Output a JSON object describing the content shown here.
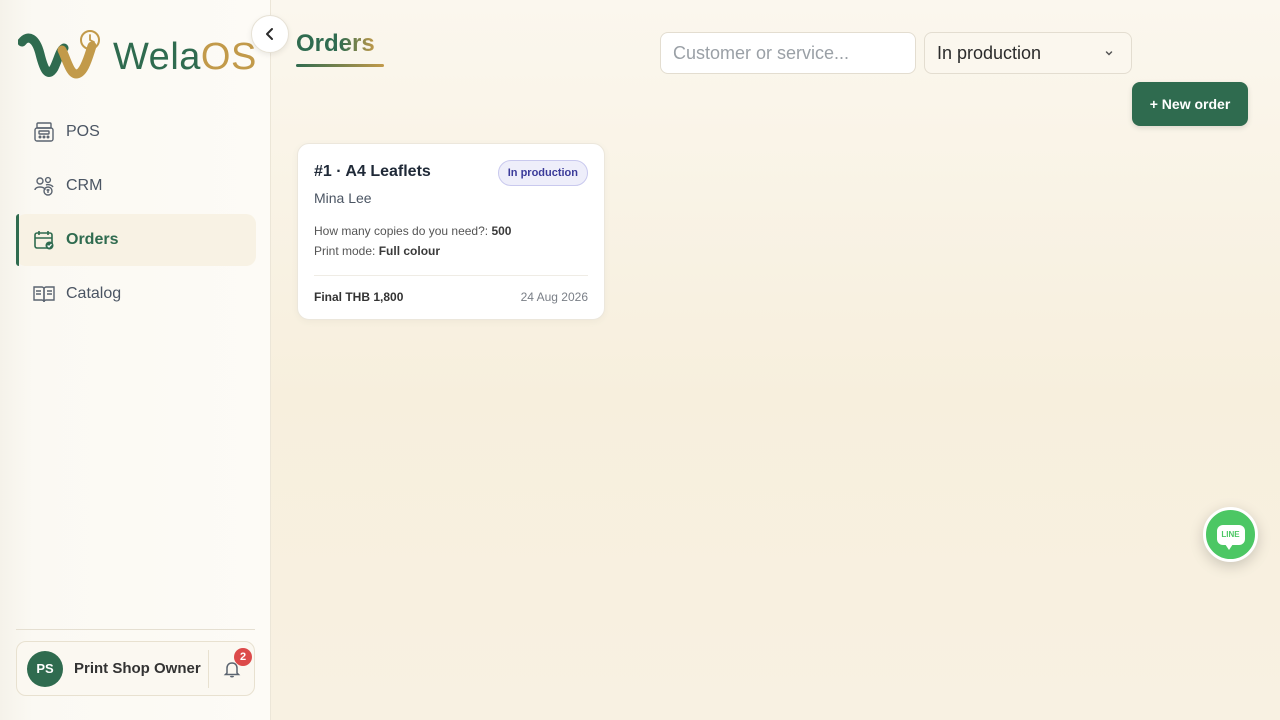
{
  "brand": {
    "name_part1": "Wela",
    "name_part2": "OS"
  },
  "sidebar": {
    "items": [
      {
        "label": "POS",
        "icon": "cash-register-icon",
        "active": false
      },
      {
        "label": "CRM",
        "icon": "customers-icon",
        "active": false
      },
      {
        "label": "Orders",
        "icon": "calendar-check-icon",
        "active": true
      },
      {
        "label": "Catalog",
        "icon": "catalog-book-icon",
        "active": false
      }
    ],
    "user": {
      "initials": "PS",
      "name": "Print Shop Owner",
      "notifications": "2"
    }
  },
  "header": {
    "title": "Orders",
    "search_placeholder": "Customer or service...",
    "status_filter": "In production",
    "new_order_label": "+ New order"
  },
  "orders": [
    {
      "title": "#1 · A4 Leaflets",
      "status": "In production",
      "customer": "Mina Lee",
      "fields": [
        {
          "label": "How many copies do you need?: ",
          "value": "500"
        },
        {
          "label": "Print mode: ",
          "value": "Full colour"
        }
      ],
      "total": "Final THB 1,800",
      "date": "24 Aug 2026"
    }
  ],
  "fab": {
    "label": "LINE"
  },
  "colors": {
    "primary": "#2f6b4f",
    "gold": "#c29a4a",
    "line_green": "#4cc764",
    "badge_red": "#dc4a4a"
  }
}
